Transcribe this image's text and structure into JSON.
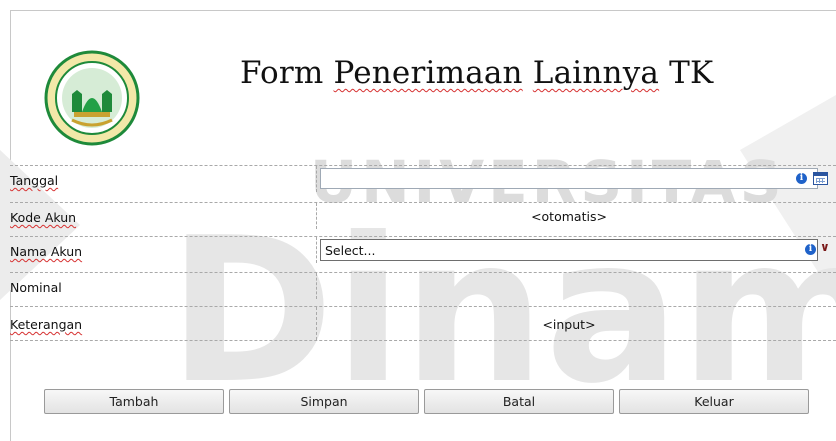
{
  "form": {
    "title_parts": [
      "Form ",
      "Penerimaan",
      " ",
      "Lainnya",
      " TK"
    ],
    "logo": "school-logo"
  },
  "watermark": {
    "top": "UNIVERSITAS",
    "bottom": "Dinamika"
  },
  "fields": [
    {
      "label": "Tanggal",
      "value": "",
      "icons": [
        "info-icon",
        "calendar-icon"
      ]
    },
    {
      "label": "Kode Akun",
      "value": "<otomatis>"
    },
    {
      "label": "Nama Akun",
      "value": "Select...",
      "icons": [
        "info-icon",
        "chevron-down-icon"
      ]
    },
    {
      "label": "Nominal",
      "value": ""
    },
    {
      "label": "Keterangan",
      "value": "<input>"
    }
  ],
  "buttons": {
    "tambah": "Tambah",
    "simpan": "Simpan",
    "batal": "Batal",
    "keluar": "Keluar"
  },
  "colors": {
    "watermark": "#d8d8d8",
    "accent": "#1f62c9",
    "logo_green": "#1e8a3a"
  }
}
